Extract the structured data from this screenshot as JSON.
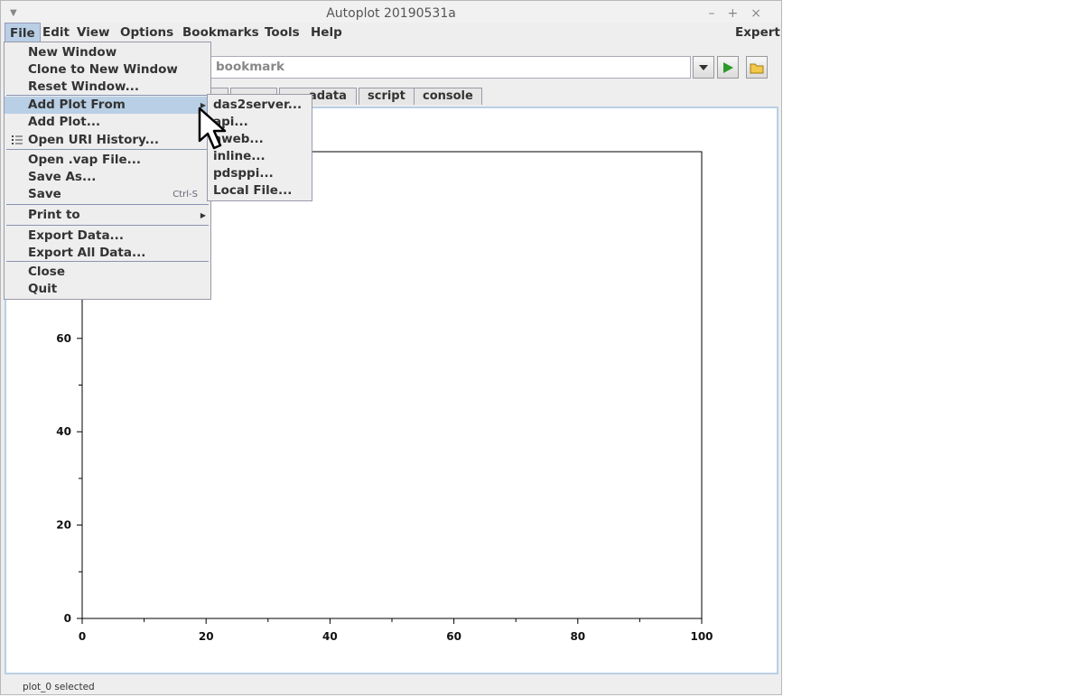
{
  "window": {
    "title": "Autoplot 20190531a"
  },
  "menubar": {
    "items": [
      "File",
      "Edit",
      "View",
      "Options",
      "Bookmarks",
      "Tools",
      "Help"
    ],
    "expert": "Expert"
  },
  "uri": {
    "placeholder": "bookmark"
  },
  "tabs": [
    "",
    "",
    "adata",
    "script",
    "console"
  ],
  "file_menu": {
    "items": [
      {
        "label": "New Window"
      },
      {
        "label": "Clone to New Window"
      },
      {
        "label": "Reset Window..."
      },
      {
        "label": "Add Plot From",
        "submenu": true,
        "highlighted": true
      },
      {
        "label": "Add Plot..."
      },
      {
        "label": "Open URI History...",
        "icon": "list-icon"
      },
      {
        "label": "Open .vap File..."
      },
      {
        "label": "Save As..."
      },
      {
        "label": "Save",
        "accelerator": "Ctrl-S"
      },
      {
        "label": "Print to",
        "submenu": true
      },
      {
        "label": "Export Data..."
      },
      {
        "label": "Export All Data..."
      },
      {
        "label": "Close"
      },
      {
        "label": "Quit"
      }
    ]
  },
  "submenu": {
    "items": [
      "das2server...",
      "api...",
      "aweb...",
      "inline...",
      "pdsppi...",
      "Local File..."
    ]
  },
  "chart_data": {
    "type": "line",
    "series": [],
    "x_ticks": [
      "0",
      "20",
      "40",
      "60",
      "80",
      "100"
    ],
    "y_ticks": [
      "0",
      "20",
      "40",
      "60"
    ],
    "xlim": [
      0,
      100
    ],
    "ylim": [
      0,
      100
    ],
    "grid": false
  },
  "status": {
    "text": "plot_0 selected"
  },
  "colors": {
    "highlight": "#b8cfe5",
    "menu_bg": "#eeeeee",
    "run_arrow": "#2a9a2a"
  }
}
